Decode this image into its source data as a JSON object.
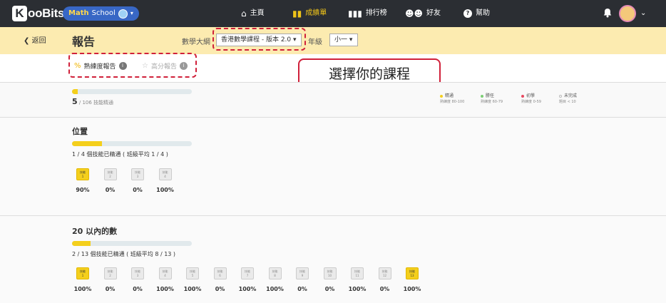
{
  "nav": {
    "logo_k": "K",
    "logo_text": "ooBits",
    "school_part1": "Math",
    "school_part2": "School",
    "items": [
      {
        "icon": "⌂",
        "label": "主頁"
      },
      {
        "icon": "▮▮",
        "label": "成績單"
      },
      {
        "icon": "▮▮▮",
        "label": "排行榜"
      },
      {
        "icon": "☻☻",
        "label": "好友"
      },
      {
        "icon": "?",
        "label": "幫助"
      }
    ],
    "bell": "🔔",
    "active_color": "#f0c419"
  },
  "header": {
    "back_label": "返回",
    "title": "報告",
    "syllabus_label": "數學大綱",
    "curriculum": "香港數學課程 - 版本 2.0",
    "grade_label": "年級",
    "grade": "小一"
  },
  "tabs": [
    {
      "icon": "%",
      "label": "熟練度報告"
    },
    {
      "icon": "☆",
      "label": "高分報告"
    }
  ],
  "callout": "選擇你的課程",
  "summary": {
    "mastered": "5",
    "suffix": "/ 106 技能精通",
    "progress": 0.047
  },
  "legend": [
    {
      "label": "精通",
      "range": "熟練度 80-100",
      "color": "#f4cf1c"
    },
    {
      "label": "勝任",
      "range": "熟練度 60-79",
      "color": "#7ccf74"
    },
    {
      "label": "初學",
      "range": "熟練度 0-59",
      "color": "#e8495f"
    },
    {
      "label": "未完成",
      "range": "題目 < 10",
      "color": "#cccccc"
    }
  ],
  "topics": [
    {
      "title": "位置",
      "stat": "1 / 4 個技能已精通 ( 班級平均 1 / 4 )",
      "progress": 0.25,
      "skills": [
        {
          "tag": "技能",
          "num": "1",
          "pct": "90%",
          "m": true
        },
        {
          "tag": "技能",
          "num": "2",
          "pct": "0%",
          "m": false
        },
        {
          "tag": "技能",
          "num": "3",
          "pct": "0%",
          "m": false
        },
        {
          "tag": "技能",
          "num": "4",
          "pct": "100%",
          "m": false
        }
      ]
    },
    {
      "title": "20 以內的數",
      "stat": "2 / 13 個技能已精通 ( 班級平均 8 / 13 )",
      "progress": 0.154,
      "skills": [
        {
          "tag": "技能",
          "num": "1",
          "pct": "100%",
          "m": true
        },
        {
          "tag": "技能",
          "num": "2",
          "pct": "0%",
          "m": false
        },
        {
          "tag": "技能",
          "num": "3",
          "pct": "0%",
          "m": false
        },
        {
          "tag": "技能",
          "num": "4",
          "pct": "100%",
          "m": false
        },
        {
          "tag": "技能",
          "num": "5",
          "pct": "100%",
          "m": false
        },
        {
          "tag": "技能",
          "num": "6",
          "pct": "0%",
          "m": false
        },
        {
          "tag": "技能",
          "num": "7",
          "pct": "100%",
          "m": false
        },
        {
          "tag": "技能",
          "num": "8",
          "pct": "100%",
          "m": false
        },
        {
          "tag": "技能",
          "num": "9",
          "pct": "0%",
          "m": false
        },
        {
          "tag": "技能",
          "num": "10",
          "pct": "0%",
          "m": false
        },
        {
          "tag": "技能",
          "num": "11",
          "pct": "100%",
          "m": false
        },
        {
          "tag": "技能",
          "num": "12",
          "pct": "0%",
          "m": false
        },
        {
          "tag": "技能",
          "num": "13",
          "pct": "100%",
          "m": true
        }
      ]
    }
  ]
}
